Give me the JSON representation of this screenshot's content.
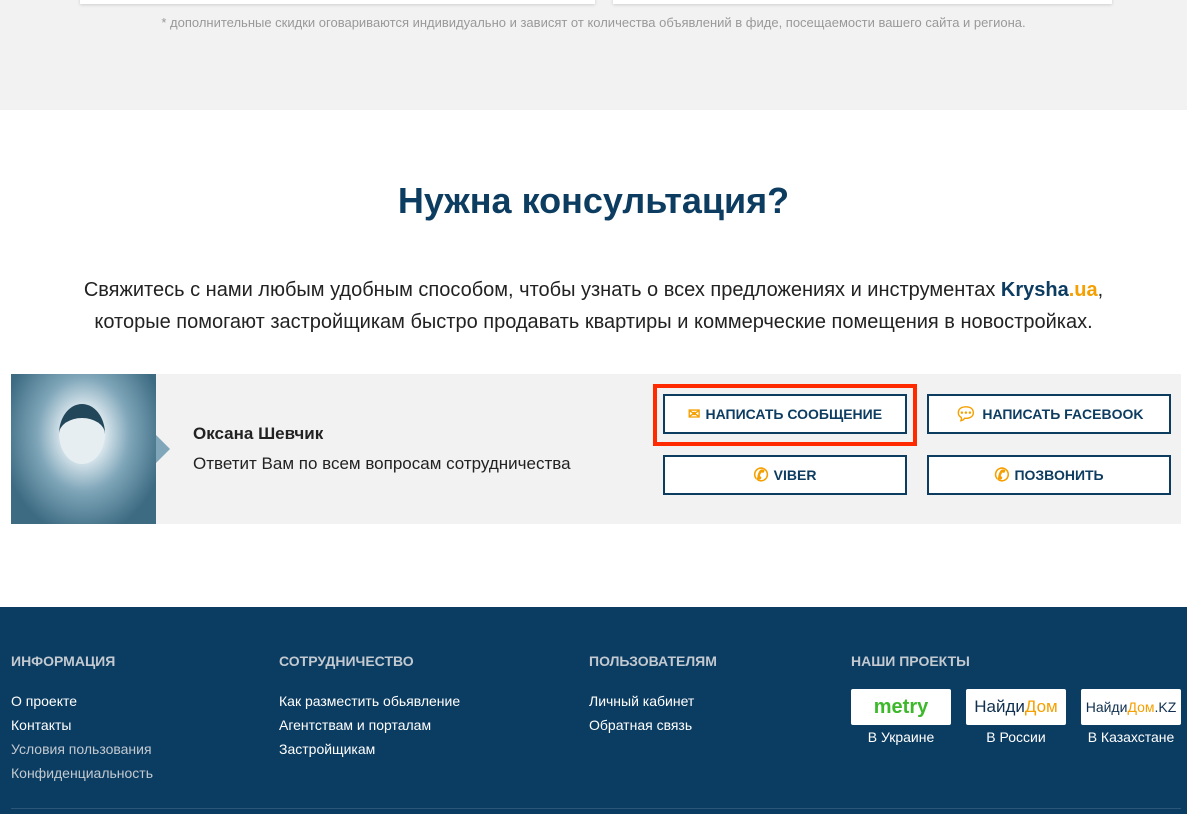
{
  "footnote": "* дополнительные скидки оговариваются индивидуально и зависят от количества объявлений в фиде, посещаемости вашего сайта и региона.",
  "heading": "Нужна консультация?",
  "lead": {
    "before": "Свяжитесь с нами любым удобным способом, чтобы узнать о всех предложениях и инструментах ",
    "brand": "Krysha",
    "brand_tld": ".ua",
    "after": ",",
    "line2": "которые помогают застройщикам быстро продавать квартиры и коммерческие помещения в новостройках."
  },
  "contact": {
    "name": "Оксана Шевчик",
    "desc": "Ответит Вам по всем вопросам сотрудничества"
  },
  "buttons": {
    "message": "НАПИСАТЬ СООБЩЕНИЕ",
    "facebook": "НАПИСАТЬ FACEBOOK",
    "viber": "VIBER",
    "call": "ПОЗВОНИТЬ"
  },
  "footer": {
    "info": {
      "title": "ИНФОРМАЦИЯ",
      "links": [
        "О проекте",
        "Контакты",
        "Условия пользования",
        "Конфиденциальность"
      ]
    },
    "coop": {
      "title": "СОТРУДНИЧЕСТВО",
      "links": [
        "Как разместить обьявление",
        "Агентствам и порталам",
        "Застройщикам"
      ]
    },
    "users": {
      "title": "ПОЛЬЗОВАТЕЛЯМ",
      "links": [
        "Личный кабинет",
        "Обратная связь"
      ]
    },
    "projects": {
      "title": "НАШИ ПРОЕКТЫ",
      "items": [
        {
          "logo": "metry",
          "label": "В Украине"
        },
        {
          "logo_a": "Найди",
          "logo_b": "Дом",
          "label": "В России"
        },
        {
          "logo_a": "Найди",
          "logo_b": "Дом",
          "logo_c": ".KZ",
          "label": "В Казахстане"
        }
      ]
    }
  }
}
